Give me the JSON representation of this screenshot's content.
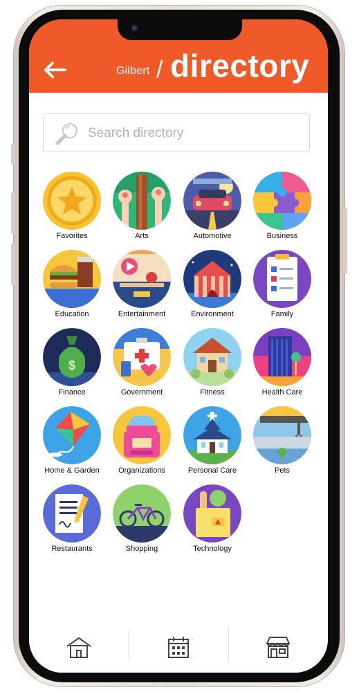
{
  "header": {
    "city": "Gilbert",
    "separator": "/",
    "title": "directory",
    "color": "#f05a28"
  },
  "search": {
    "placeholder": "Search directory",
    "value": ""
  },
  "categories": [
    {
      "label": "Favorites",
      "icon": "star-icon"
    },
    {
      "label": "Arts",
      "icon": "paint-brushes-icon"
    },
    {
      "label": "Automotive",
      "icon": "car-icon"
    },
    {
      "label": "Business",
      "icon": "puzzle-icon"
    },
    {
      "label": "Education",
      "icon": "burger-drink-icon"
    },
    {
      "label": "Entertainment",
      "icon": "media-player-icon"
    },
    {
      "label": "Environment",
      "icon": "circus-tent-icon"
    },
    {
      "label": "Family",
      "icon": "checklist-clipboard-icon"
    },
    {
      "label": "Finance",
      "icon": "money-bag-icon"
    },
    {
      "label": "Government",
      "icon": "medical-kit-icon"
    },
    {
      "label": "Fitness",
      "icon": "house-icon"
    },
    {
      "label": "Health Care",
      "icon": "city-building-icon"
    },
    {
      "label": "Home & Garden",
      "icon": "kite-icon"
    },
    {
      "label": "Organizations",
      "icon": "cosmetic-jar-icon"
    },
    {
      "label": "Personal Care",
      "icon": "chapel-icon"
    },
    {
      "label": "Pets",
      "icon": "crane-icon"
    },
    {
      "label": "Restaurants",
      "icon": "document-pen-icon"
    },
    {
      "label": "Shopping",
      "icon": "bicycle-icon"
    },
    {
      "label": "Technology",
      "icon": "grocery-bag-icon"
    }
  ],
  "tabbar": [
    {
      "name": "home",
      "icon": "home-icon"
    },
    {
      "name": "calendar",
      "icon": "calendar-icon"
    },
    {
      "name": "shop",
      "icon": "storefront-icon"
    }
  ]
}
